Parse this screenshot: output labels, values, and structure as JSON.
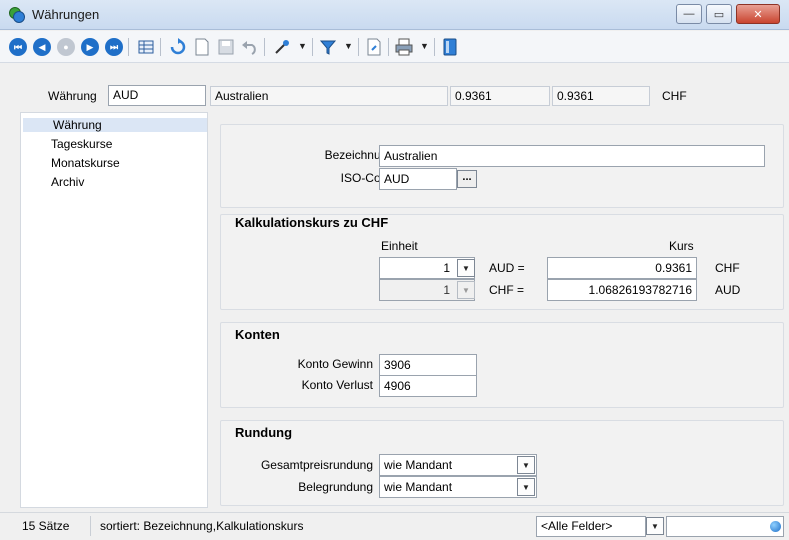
{
  "window": {
    "title": "Währungen",
    "controls": {
      "minimize": "—",
      "maximize": "▭",
      "close": "✕"
    }
  },
  "toolbar": {
    "icons": [
      "first-record",
      "previous-record",
      "refresh-record",
      "next-record",
      "last-record",
      "table-view",
      "reload",
      "new",
      "save",
      "undo",
      "edit",
      "filter",
      "export",
      "print",
      "book"
    ]
  },
  "header": {
    "currency_label": "Währung",
    "currency_value": "AUD",
    "country": "Australien",
    "rate1": "0.9361",
    "rate2": "0.9361",
    "base": "CHF"
  },
  "sidebar": {
    "items": [
      {
        "label": "Währung",
        "active": true
      },
      {
        "label": "Tageskurse"
      },
      {
        "label": "Monatskurse"
      },
      {
        "label": "Archiv"
      }
    ]
  },
  "general": {
    "name_label": "Bezeichnung",
    "name_value": "Australien",
    "iso_label": "ISO-Code",
    "iso_value": "AUD",
    "iso_button": "..."
  },
  "calc": {
    "title": "Kalkulationskurs zu CHF",
    "col_unit": "Einheit",
    "col_rate": "Kurs",
    "rows": [
      {
        "unit": "1",
        "expr": "AUD =",
        "rate": "0.9361",
        "currency": "CHF"
      },
      {
        "unit": "1",
        "expr": "CHF =",
        "rate": "1.06826193782716",
        "currency": "AUD"
      }
    ]
  },
  "accounts": {
    "title": "Konten",
    "gain_label": "Konto Gewinn",
    "gain_value": "3906",
    "loss_label": "Konto Verlust",
    "loss_value": "4906"
  },
  "rounding": {
    "title": "Rundung",
    "total_label": "Gesamtpreisrundung",
    "total_value": "wie Mandant",
    "doc_label": "Belegrundung",
    "doc_value": "wie Mandant"
  },
  "status": {
    "count": "15 Sätze",
    "sorted": "sortiert: Bezeichnung,Kalkulationskurs",
    "field_select": "<Alle Felder>",
    "search_value": ""
  },
  "colors": {
    "accent": "#1f6fc8",
    "selected_bg": "#dbe6f5",
    "close_button": "#c9442f"
  }
}
